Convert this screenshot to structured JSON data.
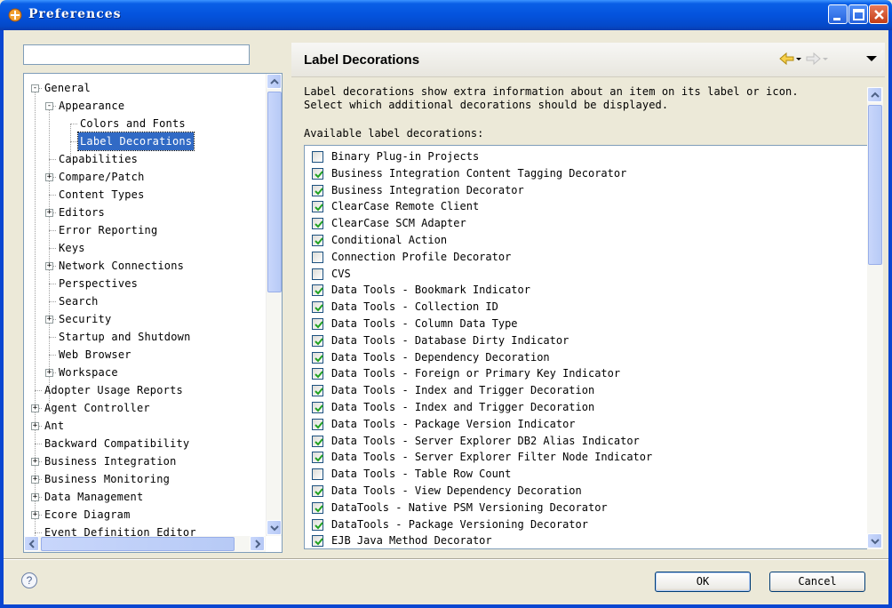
{
  "window": {
    "title": "Preferences"
  },
  "filter": {
    "value": "",
    "placeholder": ""
  },
  "tree": [
    {
      "label": "General",
      "level": 0,
      "expander": "-"
    },
    {
      "label": "Appearance",
      "level": 1,
      "expander": "-"
    },
    {
      "label": "Colors and Fonts",
      "level": 2,
      "expander": ""
    },
    {
      "label": "Label Decorations",
      "level": 2,
      "expander": "",
      "selected": true
    },
    {
      "label": "Capabilities",
      "level": 1,
      "expander": ""
    },
    {
      "label": "Compare/Patch",
      "level": 1,
      "expander": "+"
    },
    {
      "label": "Content Types",
      "level": 1,
      "expander": ""
    },
    {
      "label": "Editors",
      "level": 1,
      "expander": "+"
    },
    {
      "label": "Error Reporting",
      "level": 1,
      "expander": ""
    },
    {
      "label": "Keys",
      "level": 1,
      "expander": ""
    },
    {
      "label": "Network Connections",
      "level": 1,
      "expander": "+"
    },
    {
      "label": "Perspectives",
      "level": 1,
      "expander": ""
    },
    {
      "label": "Search",
      "level": 1,
      "expander": ""
    },
    {
      "label": "Security",
      "level": 1,
      "expander": "+"
    },
    {
      "label": "Startup and Shutdown",
      "level": 1,
      "expander": ""
    },
    {
      "label": "Web Browser",
      "level": 1,
      "expander": ""
    },
    {
      "label": "Workspace",
      "level": 1,
      "expander": "+"
    },
    {
      "label": "Adopter Usage Reports",
      "level": 0,
      "expander": ""
    },
    {
      "label": "Agent Controller",
      "level": 0,
      "expander": "+"
    },
    {
      "label": "Ant",
      "level": 0,
      "expander": "+"
    },
    {
      "label": "Backward Compatibility",
      "level": 0,
      "expander": ""
    },
    {
      "label": "Business Integration",
      "level": 0,
      "expander": "+"
    },
    {
      "label": "Business Monitoring",
      "level": 0,
      "expander": "+"
    },
    {
      "label": "Data Management",
      "level": 0,
      "expander": "+"
    },
    {
      "label": "Ecore Diagram",
      "level": 0,
      "expander": "+"
    },
    {
      "label": "Event Definition Editor",
      "level": 0,
      "expander": ""
    }
  ],
  "page": {
    "title": "Label Decorations",
    "description_line1": "Label decorations show extra information about an item on its label or icon.",
    "description_line2": "Select which additional decorations should be displayed.",
    "available_label": "Available label decorations:"
  },
  "decorations": [
    {
      "label": "Binary Plug-in Projects",
      "checked": false
    },
    {
      "label": "Business Integration Content Tagging Decorator",
      "checked": true
    },
    {
      "label": "Business Integration Decorator",
      "checked": true
    },
    {
      "label": "ClearCase Remote Client",
      "checked": true
    },
    {
      "label": "ClearCase SCM Adapter",
      "checked": true
    },
    {
      "label": "Conditional Action",
      "checked": true
    },
    {
      "label": "Connection Profile Decorator",
      "checked": false
    },
    {
      "label": "CVS",
      "checked": false
    },
    {
      "label": "Data Tools - Bookmark Indicator",
      "checked": true
    },
    {
      "label": "Data Tools - Collection ID",
      "checked": true
    },
    {
      "label": "Data Tools - Column Data Type",
      "checked": true
    },
    {
      "label": "Data Tools - Database Dirty Indicator",
      "checked": true
    },
    {
      "label": "Data Tools - Dependency Decoration",
      "checked": true
    },
    {
      "label": "Data Tools - Foreign or Primary Key Indicator",
      "checked": true
    },
    {
      "label": "Data Tools - Index and Trigger Decoration",
      "checked": true
    },
    {
      "label": "Data Tools - Index and Trigger Decoration",
      "checked": true
    },
    {
      "label": "Data Tools - Package Version Indicator",
      "checked": true
    },
    {
      "label": "Data Tools - Server Explorer DB2 Alias Indicator",
      "checked": true
    },
    {
      "label": "Data Tools - Server Explorer Filter Node Indicator",
      "checked": true
    },
    {
      "label": "Data Tools - Table Row Count",
      "checked": false
    },
    {
      "label": "Data Tools - View Dependency Decoration",
      "checked": true
    },
    {
      "label": "DataTools - Native PSM Versioning Decorator",
      "checked": true
    },
    {
      "label": "DataTools - Package Versioning Decorator",
      "checked": true
    },
    {
      "label": "EJB Java Method Decorator",
      "checked": true
    }
  ],
  "buttons": {
    "ok": "OK",
    "cancel": "Cancel",
    "help": "?"
  },
  "colors": {
    "titlebar": "#0453dd",
    "selection": "#316ac5",
    "checkmark": "#21a121"
  }
}
